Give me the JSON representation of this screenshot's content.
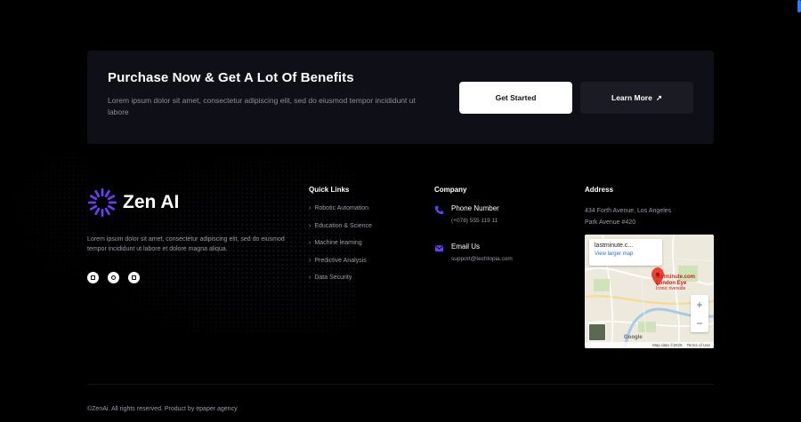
{
  "cta": {
    "title": "Purchase Now & Get A Lot Of Benefits",
    "description": "Lorem ipsum dolor sit amet, consectetur adipiscing elit, sed do eiusmod tempor incididunt ut labore",
    "primary_button": "Get Started",
    "secondary_button": "Learn More",
    "secondary_icon": "↗"
  },
  "brand": {
    "name": "Zen AI",
    "description": "Lorem ipsum dolor sit amet, consectetur adipiscing elit, sed do eiusmod tempor incididunt ut labore et dolore magna aliqua.",
    "socials": [
      {
        "icon": "facebook-icon"
      },
      {
        "icon": "instagram-icon"
      },
      {
        "icon": "linkedin-icon"
      }
    ]
  },
  "quick_links": {
    "title": "Quick Links",
    "items": [
      "Robotic Automation",
      "Education & Science",
      "Machine learning",
      "Predictive Analysis",
      "Data Security"
    ]
  },
  "company": {
    "title": "Company",
    "phone_label": "Phone Number",
    "phone_value": "(+078) 555 119 11",
    "email_label": "Email Us",
    "email_value": "support@techtopia.com"
  },
  "address": {
    "title": "Address",
    "line1": "434 Forth Avenue, Los Angeles",
    "line2": "Park Avenue #420"
  },
  "map": {
    "card_title": "lastminute.c...",
    "card_link": "View larger map",
    "pin_label_1": "lastminute.com",
    "pin_label_2": "London Eye",
    "pin_label_3": "Iconic riverside",
    "zoom_in": "+",
    "zoom_out": "−",
    "google": "Google",
    "footer_data": "Map data ©2025",
    "footer_terms": "Terms of Use"
  },
  "footer": {
    "copyright": "©ZenAi. All rights reserved. Product by epaper agency"
  },
  "colors": {
    "accent": "#6b3df5",
    "background": "#000000",
    "panel": "#0f1017"
  }
}
